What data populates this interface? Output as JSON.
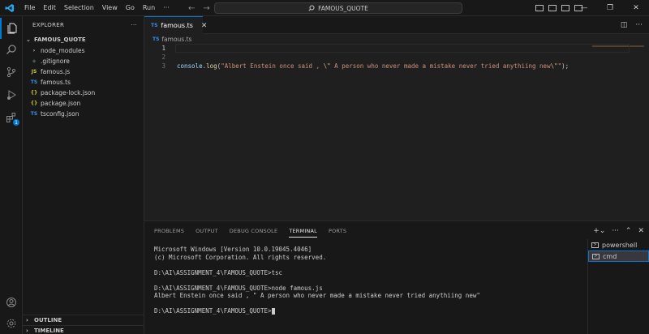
{
  "titlebar": {
    "menu": [
      "File",
      "Edit",
      "Selection",
      "View",
      "Go",
      "Run",
      "···"
    ],
    "search_text": "FAMOUS_QUOTE"
  },
  "sidebar": {
    "header": "EXPLORER",
    "more": "···",
    "folder": "FAMOUS_QUOTE",
    "items": [
      {
        "label": "node_modules",
        "icon": "chevron-right-icon",
        "glyph": "›",
        "color": "#cccccc"
      },
      {
        "label": ".gitignore",
        "icon": "gitignore-icon",
        "glyph": "◆",
        "color": "#41535b"
      },
      {
        "label": "famous.js",
        "icon": "js-file-icon",
        "glyph": "JS",
        "color": "#cbcb41"
      },
      {
        "label": "famous.ts",
        "icon": "ts-file-icon",
        "glyph": "TS",
        "color": "#3b8eea"
      },
      {
        "label": "package-lock.json",
        "icon": "json-file-icon",
        "glyph": "{}",
        "color": "#cbcb41"
      },
      {
        "label": "package.json",
        "icon": "json-file-icon",
        "glyph": "{}",
        "color": "#cbcb41"
      },
      {
        "label": "tsconfig.json",
        "icon": "tsconfig-file-icon",
        "glyph": "TS",
        "color": "#3b8eea"
      }
    ],
    "outline": "OUTLINE",
    "timeline": "TIMELINE"
  },
  "activity": {
    "extensions_badge": "1"
  },
  "editor": {
    "tab_label": "famous.ts",
    "tab_icon": "TS",
    "breadcrumb": "famous.ts",
    "line_numbers": [
      "1",
      "2",
      "3"
    ],
    "code": {
      "obj": "console",
      "dot": ".",
      "fn": "log",
      "open": "(",
      "str1": "\"Albert Enstein once said , ",
      "esc1": "\\\"",
      "str2": " A person who never made a mistake never tried anythiing new",
      "esc2": "\\\"",
      "str3": "\"",
      "close": ");"
    }
  },
  "panel": {
    "tabs": [
      "PROBLEMS",
      "OUTPUT",
      "DEBUG CONSOLE",
      "TERMINAL",
      "PORTS"
    ],
    "terminal_lines": [
      "Microsoft Windows [Version 10.0.19045.4046]",
      "(c) Microsoft Corporation. All rights reserved.",
      "",
      "D:\\AI\\ASSIGNMENT_4\\FAMOUS_QUOTE>tsc",
      "",
      "D:\\AI\\ASSIGNMENT_4\\FAMOUS_QUOTE>node famous.js",
      "Albert Enstein once said , \" A person who never made a mistake never tried anythiing new\"",
      "",
      "D:\\AI\\ASSIGNMENT_4\\FAMOUS_QUOTE>"
    ],
    "terminals": [
      "powershell",
      "cmd"
    ]
  },
  "colors": {
    "accent": "#0078d4",
    "background": "#1f1f1f"
  }
}
